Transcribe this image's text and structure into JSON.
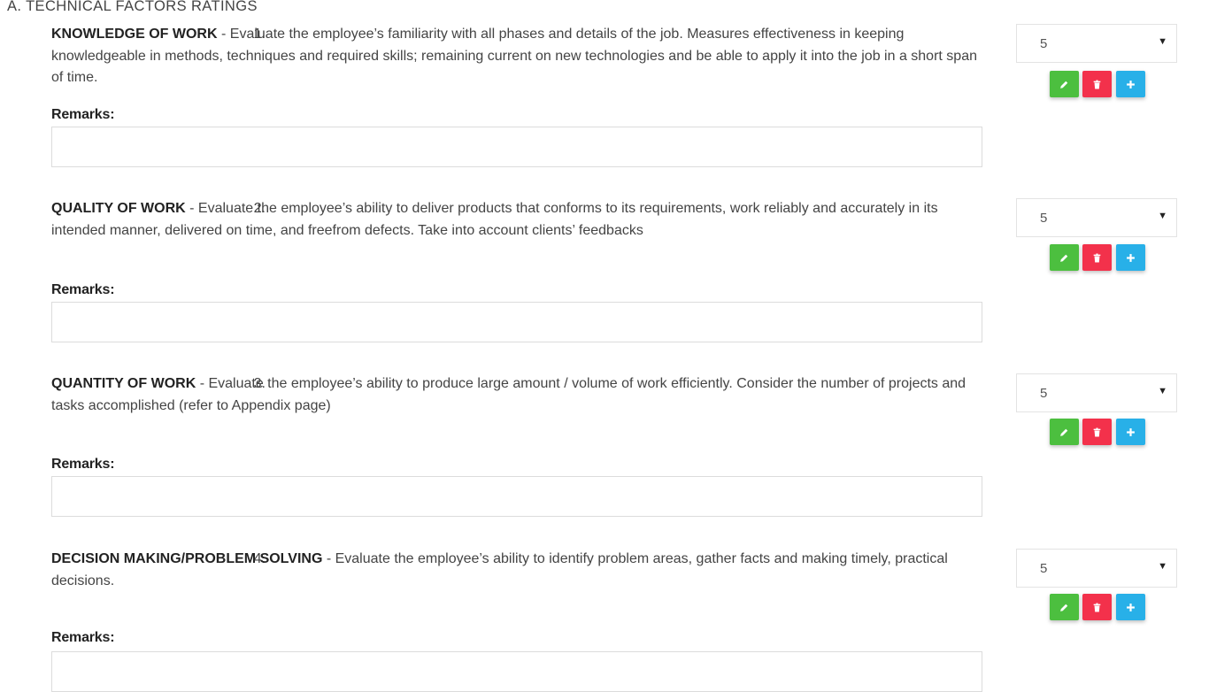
{
  "section": {
    "title": "A. TECHNICAL FACTORS RATINGS"
  },
  "remarks_label": "Remarks:",
  "colors": {
    "edit": "#4cbf3f",
    "delete": "#f3314b",
    "add": "#28b0e8"
  },
  "items": [
    {
      "number": "1.",
      "title": "KNOWLEDGE OF WORK",
      "description": " - Evaluate the employee’s familiarity with all phases and details of the job. Measures effectiveness in keeping knowledgeable in methods, techniques and required skills; remaining current on new technologies and be able to apply it into the job in a short span of time.",
      "rating": "5",
      "remarks_value": ""
    },
    {
      "number": "2.",
      "title": "QUALITY OF WORK",
      "description": " - Evaluate the employee’s ability to deliver products that conforms to its requirements, work reliably and accurately in its intended manner, delivered on time, and freefrom defects. Take into account clients’ feedbacks",
      "rating": "5",
      "remarks_value": ""
    },
    {
      "number": "3.",
      "title": "QUANTITY OF WORK",
      "description": " - Evaluate the employee’s ability to produce large amount / volume of work efficiently. Consider the number of projects and tasks accomplished (refer to Appendix page)",
      "rating": "5",
      "remarks_value": ""
    },
    {
      "number": "4.",
      "title": "DECISION MAKING/PROBLEM SOLVING",
      "description": " - Evaluate the employee’s ability to identify problem areas, gather facts and making timely, practical decisions.",
      "rating": "5",
      "remarks_value": ""
    }
  ],
  "icons": {
    "edit": "pencil-icon",
    "delete": "trash-icon",
    "add": "plus-icon",
    "caret": "caret-down-icon"
  }
}
